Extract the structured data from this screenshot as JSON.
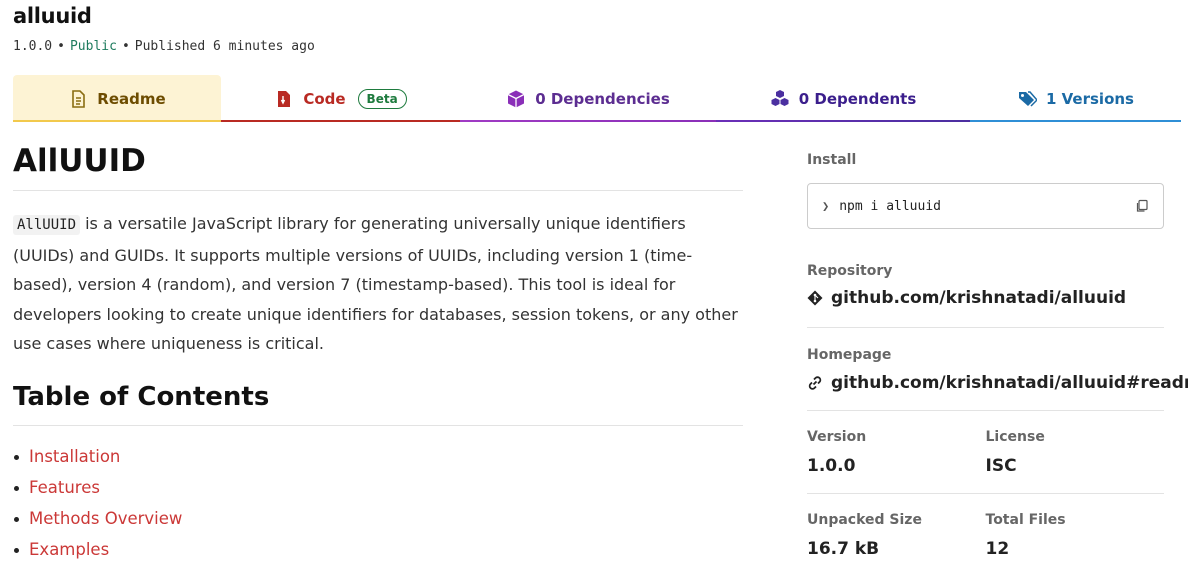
{
  "package": {
    "name": "alluuid",
    "version": "1.0.0",
    "visibility": "Public",
    "separator": "•",
    "published": "Published 6 minutes ago"
  },
  "tabs": {
    "readme": "Readme",
    "code": "Code",
    "code_badge": "Beta",
    "dependencies": "0 Dependencies",
    "dependents": "0 Dependents",
    "versions": "1 Versions"
  },
  "readme": {
    "title": "AllUUID",
    "intro_code": "AllUUID",
    "intro_text": " is a versatile JavaScript library for generating universally unique identifiers (UUIDs) and GUIDs. It supports multiple versions of UUIDs, including version 1 (time-based), version 4 (random), and version 7 (timestamp-based). This tool is ideal for developers looking to create unique identifiers for databases, session tokens, or any other use cases where uniqueness is critical.",
    "toc_heading": "Table of Contents",
    "toc": [
      "Installation",
      "Features",
      "Methods Overview",
      "Examples"
    ]
  },
  "sidebar": {
    "install_label": "Install",
    "install_prompt": "❯",
    "install_command": "npm i alluuid",
    "repository_label": "Repository",
    "repository_url": "github.com/krishnatadi/alluuid",
    "homepage_label": "Homepage",
    "homepage_url": "github.com/krishnatadi/alluuid#readme",
    "version_label": "Version",
    "version_value": "1.0.0",
    "license_label": "License",
    "license_value": "ISC",
    "unpacked_label": "Unpacked Size",
    "unpacked_value": "16.7 kB",
    "files_label": "Total Files",
    "files_value": "12"
  },
  "colors": {
    "readme_tab": "#fdf3d4",
    "code_tab": "#b92a23",
    "deps_tab": "#8a2fb8",
    "dependents_tab": "#4b2fa0",
    "versions_tab": "#2f8fd6",
    "link": "#cb3837",
    "public": "#1e7b5e"
  },
  "icons": {
    "readme": "document-icon",
    "code": "code-file-icon",
    "dependencies": "box-icon",
    "dependents": "boxes-icon",
    "versions": "tags-icon",
    "copy": "copy-icon",
    "repository": "git-icon",
    "homepage": "link-icon"
  }
}
